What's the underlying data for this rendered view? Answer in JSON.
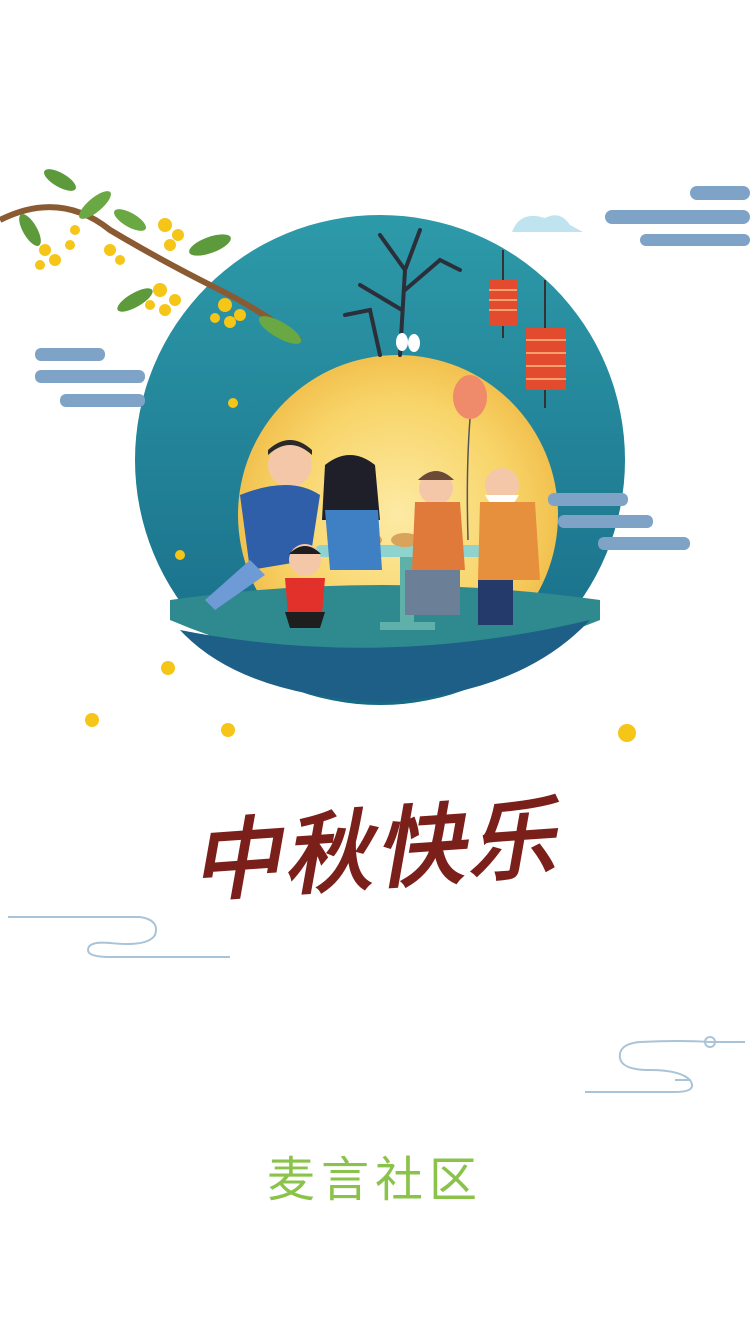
{
  "greeting": {
    "text": "中秋快乐"
  },
  "brand": {
    "name": "麦言社区"
  },
  "colors": {
    "brand": "#8bc34a",
    "greeting": "#7a1f1a",
    "moon_bg": "#1e7f97",
    "moon": "#f8d56a",
    "cloud": "#7ea3c6",
    "flower": "#f5c518"
  },
  "icons": [
    "osmanthus-branch-icon",
    "lantern-icon",
    "balloon-icon",
    "rabbit-icon",
    "cloud-icon",
    "flower-icon"
  ]
}
